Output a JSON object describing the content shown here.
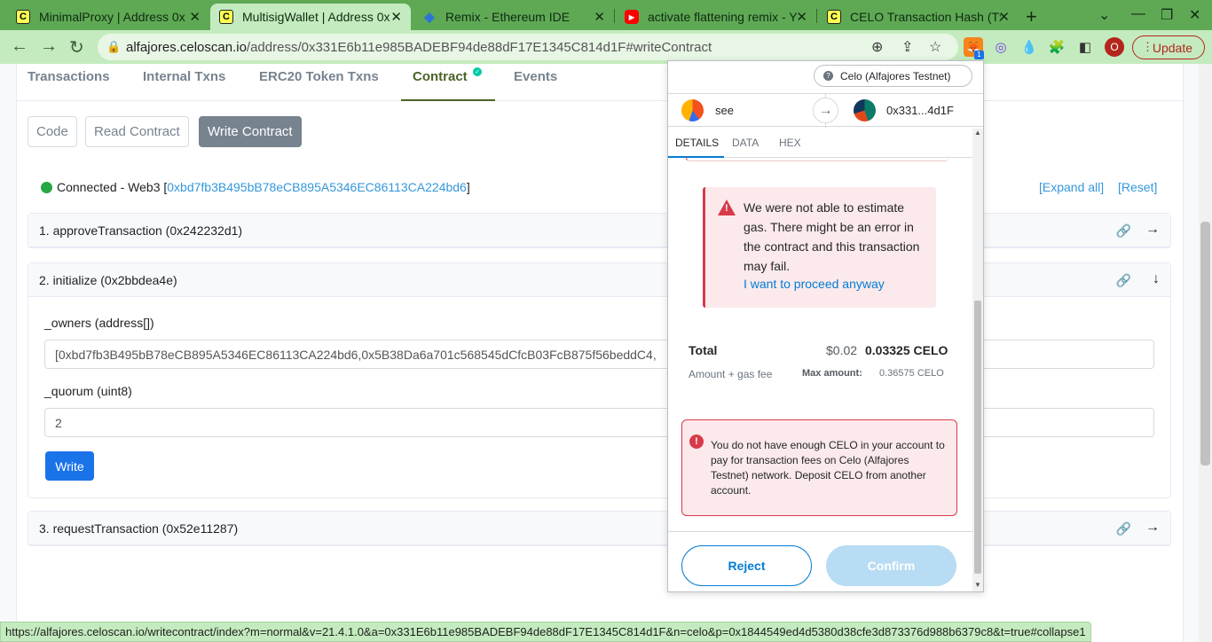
{
  "browser": {
    "tabs": [
      {
        "title": "MinimalProxy | Address 0x",
        "icon": "celo-favicon"
      },
      {
        "title": "MultisigWallet | Address 0x",
        "icon": "celo-favicon"
      },
      {
        "title": "Remix - Ethereum IDE",
        "icon": "remix-favicon"
      },
      {
        "title": "activate flattening remix - Y",
        "icon": "youtube-favicon"
      },
      {
        "title": "CELO Transaction Hash (Tx)",
        "icon": "celo-favicon"
      }
    ],
    "url_host": "alfajores.celoscan.io",
    "url_path": "/address/0x331E6b11e985BADEBF94de88dF17E1345C814d1F#writeContract",
    "update_label": "Update",
    "profile_initial": "O",
    "extension_badge": "1"
  },
  "contract_tabs": [
    "Transactions",
    "Internal Txns",
    "ERC20 Token Txns",
    "Contract",
    "Events"
  ],
  "sub_buttons": [
    "Code",
    "Read Contract",
    "Write Contract"
  ],
  "connection": {
    "prefix": "Connected - Web3 [",
    "address": "0xbd7fb3B495bB78eCB895A5346EC86113CA224bd6",
    "suffix": "]",
    "expand_all": "[Expand all]",
    "reset": "[Reset]"
  },
  "functions": [
    {
      "title": "1. approveTransaction (0x242232d1)"
    },
    {
      "title": "2. initialize (0x2bbdea4e)"
    },
    {
      "title": "3. requestTransaction (0x52e11287)"
    }
  ],
  "initialize_form": {
    "owners_label": "_owners (address[])",
    "owners_value": "[0xbd7fb3B495bB78eCB895A5346EC86113CA224bd6,0x5B38Da6a701c568545dCfcB03FcB875f56beddC4,",
    "quorum_label": "_quorum (uint8)",
    "quorum_value": "2",
    "write_label": "Write"
  },
  "status_url": "https://alfajores.celoscan.io/writecontract/index?m=normal&v=21.4.1.0&a=0x331E6b11e985BADEBF94de88dF17E1345C814d1F&n=celo&p=0x1844549ed4d5380d38cfe3d873376d988b6379c8&t=true#collapse1",
  "metamask": {
    "network": "Celo (Alfajores Testnet)",
    "from_name": "see",
    "to_address": "0x331...4d1F",
    "tabs": [
      "DETAILS",
      "DATA",
      "HEX"
    ],
    "gas_warning": "We were not able to estimate gas. There might be an error in the contract and this transaction may fail.",
    "proceed_link": "I want to proceed anyway",
    "total_label": "Total",
    "total_usd": "$0.02",
    "total_celo": "0.03325 CELO",
    "amount_gas_label": "Amount + gas fee",
    "max_amount_label": "Max amount:",
    "max_amount_value": "0.36575  CELO",
    "funds_warning": "You do not have enough CELO in your account to pay for transaction fees on Celo (Alfajores Testnet) network. Deposit CELO from another account.",
    "reject_label": "Reject",
    "confirm_label": "Confirm"
  },
  "colors": {
    "chrome_frame": "#5fa955",
    "chrome_toolbar": "#c4ebbf",
    "link_blue": "#3498db",
    "write_button": "#1a73e8",
    "contract_tab_active": "#4b6327",
    "error_red": "#d73a49",
    "metamask_blue": "#037dd6"
  }
}
